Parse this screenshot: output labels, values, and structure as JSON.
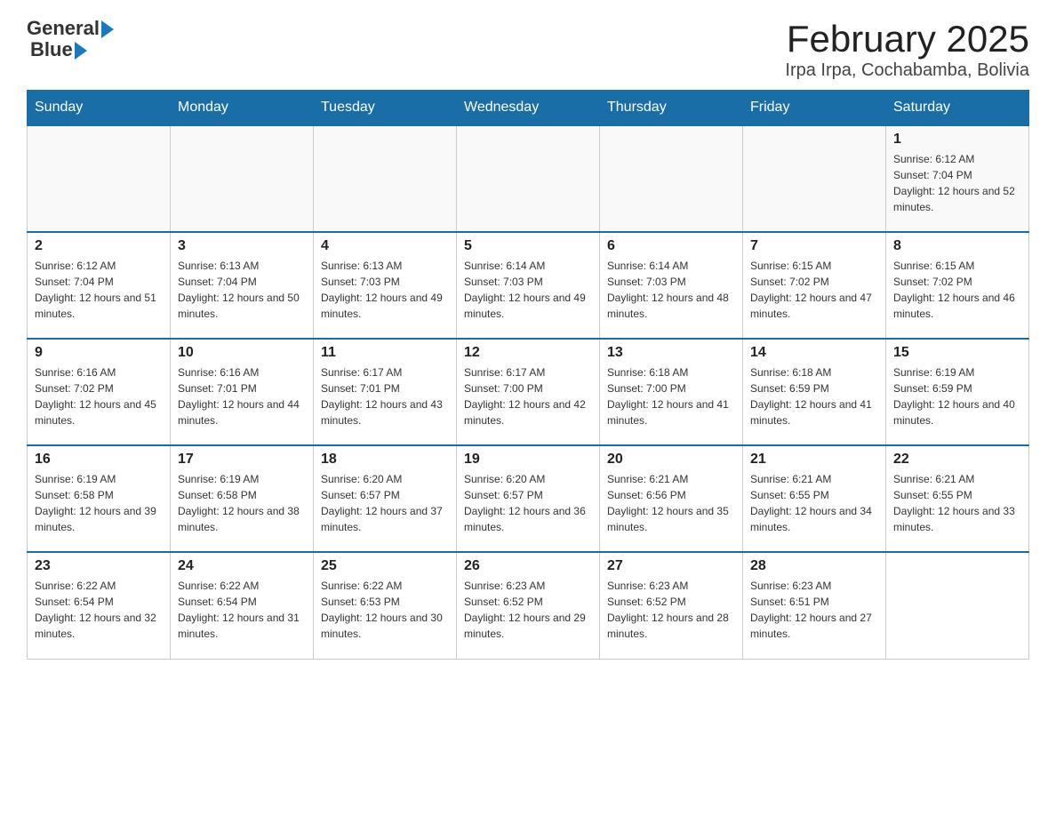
{
  "header": {
    "logo_text_general": "General",
    "logo_text_blue": "Blue",
    "title": "February 2025",
    "subtitle": "Irpa Irpa, Cochabamba, Bolivia"
  },
  "days_of_week": [
    "Sunday",
    "Monday",
    "Tuesday",
    "Wednesday",
    "Thursday",
    "Friday",
    "Saturday"
  ],
  "weeks": [
    {
      "days": [
        {
          "number": "",
          "info": ""
        },
        {
          "number": "",
          "info": ""
        },
        {
          "number": "",
          "info": ""
        },
        {
          "number": "",
          "info": ""
        },
        {
          "number": "",
          "info": ""
        },
        {
          "number": "",
          "info": ""
        },
        {
          "number": "1",
          "info": "Sunrise: 6:12 AM\nSunset: 7:04 PM\nDaylight: 12 hours and 52 minutes."
        }
      ]
    },
    {
      "days": [
        {
          "number": "2",
          "info": "Sunrise: 6:12 AM\nSunset: 7:04 PM\nDaylight: 12 hours and 51 minutes."
        },
        {
          "number": "3",
          "info": "Sunrise: 6:13 AM\nSunset: 7:04 PM\nDaylight: 12 hours and 50 minutes."
        },
        {
          "number": "4",
          "info": "Sunrise: 6:13 AM\nSunset: 7:03 PM\nDaylight: 12 hours and 49 minutes."
        },
        {
          "number": "5",
          "info": "Sunrise: 6:14 AM\nSunset: 7:03 PM\nDaylight: 12 hours and 49 minutes."
        },
        {
          "number": "6",
          "info": "Sunrise: 6:14 AM\nSunset: 7:03 PM\nDaylight: 12 hours and 48 minutes."
        },
        {
          "number": "7",
          "info": "Sunrise: 6:15 AM\nSunset: 7:02 PM\nDaylight: 12 hours and 47 minutes."
        },
        {
          "number": "8",
          "info": "Sunrise: 6:15 AM\nSunset: 7:02 PM\nDaylight: 12 hours and 46 minutes."
        }
      ]
    },
    {
      "days": [
        {
          "number": "9",
          "info": "Sunrise: 6:16 AM\nSunset: 7:02 PM\nDaylight: 12 hours and 45 minutes."
        },
        {
          "number": "10",
          "info": "Sunrise: 6:16 AM\nSunset: 7:01 PM\nDaylight: 12 hours and 44 minutes."
        },
        {
          "number": "11",
          "info": "Sunrise: 6:17 AM\nSunset: 7:01 PM\nDaylight: 12 hours and 43 minutes."
        },
        {
          "number": "12",
          "info": "Sunrise: 6:17 AM\nSunset: 7:00 PM\nDaylight: 12 hours and 42 minutes."
        },
        {
          "number": "13",
          "info": "Sunrise: 6:18 AM\nSunset: 7:00 PM\nDaylight: 12 hours and 41 minutes."
        },
        {
          "number": "14",
          "info": "Sunrise: 6:18 AM\nSunset: 6:59 PM\nDaylight: 12 hours and 41 minutes."
        },
        {
          "number": "15",
          "info": "Sunrise: 6:19 AM\nSunset: 6:59 PM\nDaylight: 12 hours and 40 minutes."
        }
      ]
    },
    {
      "days": [
        {
          "number": "16",
          "info": "Sunrise: 6:19 AM\nSunset: 6:58 PM\nDaylight: 12 hours and 39 minutes."
        },
        {
          "number": "17",
          "info": "Sunrise: 6:19 AM\nSunset: 6:58 PM\nDaylight: 12 hours and 38 minutes."
        },
        {
          "number": "18",
          "info": "Sunrise: 6:20 AM\nSunset: 6:57 PM\nDaylight: 12 hours and 37 minutes."
        },
        {
          "number": "19",
          "info": "Sunrise: 6:20 AM\nSunset: 6:57 PM\nDaylight: 12 hours and 36 minutes."
        },
        {
          "number": "20",
          "info": "Sunrise: 6:21 AM\nSunset: 6:56 PM\nDaylight: 12 hours and 35 minutes."
        },
        {
          "number": "21",
          "info": "Sunrise: 6:21 AM\nSunset: 6:55 PM\nDaylight: 12 hours and 34 minutes."
        },
        {
          "number": "22",
          "info": "Sunrise: 6:21 AM\nSunset: 6:55 PM\nDaylight: 12 hours and 33 minutes."
        }
      ]
    },
    {
      "days": [
        {
          "number": "23",
          "info": "Sunrise: 6:22 AM\nSunset: 6:54 PM\nDaylight: 12 hours and 32 minutes."
        },
        {
          "number": "24",
          "info": "Sunrise: 6:22 AM\nSunset: 6:54 PM\nDaylight: 12 hours and 31 minutes."
        },
        {
          "number": "25",
          "info": "Sunrise: 6:22 AM\nSunset: 6:53 PM\nDaylight: 12 hours and 30 minutes."
        },
        {
          "number": "26",
          "info": "Sunrise: 6:23 AM\nSunset: 6:52 PM\nDaylight: 12 hours and 29 minutes."
        },
        {
          "number": "27",
          "info": "Sunrise: 6:23 AM\nSunset: 6:52 PM\nDaylight: 12 hours and 28 minutes."
        },
        {
          "number": "28",
          "info": "Sunrise: 6:23 AM\nSunset: 6:51 PM\nDaylight: 12 hours and 27 minutes."
        },
        {
          "number": "",
          "info": ""
        }
      ]
    }
  ]
}
